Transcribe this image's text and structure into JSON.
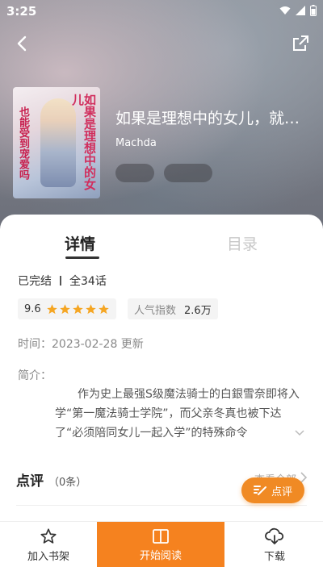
{
  "status_bar": {
    "time": "3:25"
  },
  "book": {
    "title": "如果是理想中的女儿，就…",
    "author": "Machda",
    "cover_title": "如果是理想中的女儿",
    "cover_subtitle": "也能受到宠爱吗"
  },
  "tabs": {
    "detail": "详情",
    "toc": "目录"
  },
  "details": {
    "status": "已完结",
    "chapters": "全34话",
    "rating": "9.6",
    "stars": 5,
    "popularity_label": "人气指数",
    "popularity_value": "2.6万",
    "time": "时间：2023-02-28 更新",
    "intro_label": "简介：",
    "intro_text": "作为史上最强S级魔法骑士的白銀雪奈即将入学“第一魔法骑士学院”，而父亲冬真也被下达了“必须陪同女儿一起入学”的特殊命令"
  },
  "reviews": {
    "title": "点评",
    "count": "（0条）",
    "view_all": "查看全部"
  },
  "fab": {
    "label": "点评"
  },
  "bottom_bar": {
    "add_shelf": "加入书架",
    "start_read": "开始阅读",
    "download": "下载"
  },
  "colors": {
    "accent": "#f5821f",
    "star": "#f5a623"
  }
}
